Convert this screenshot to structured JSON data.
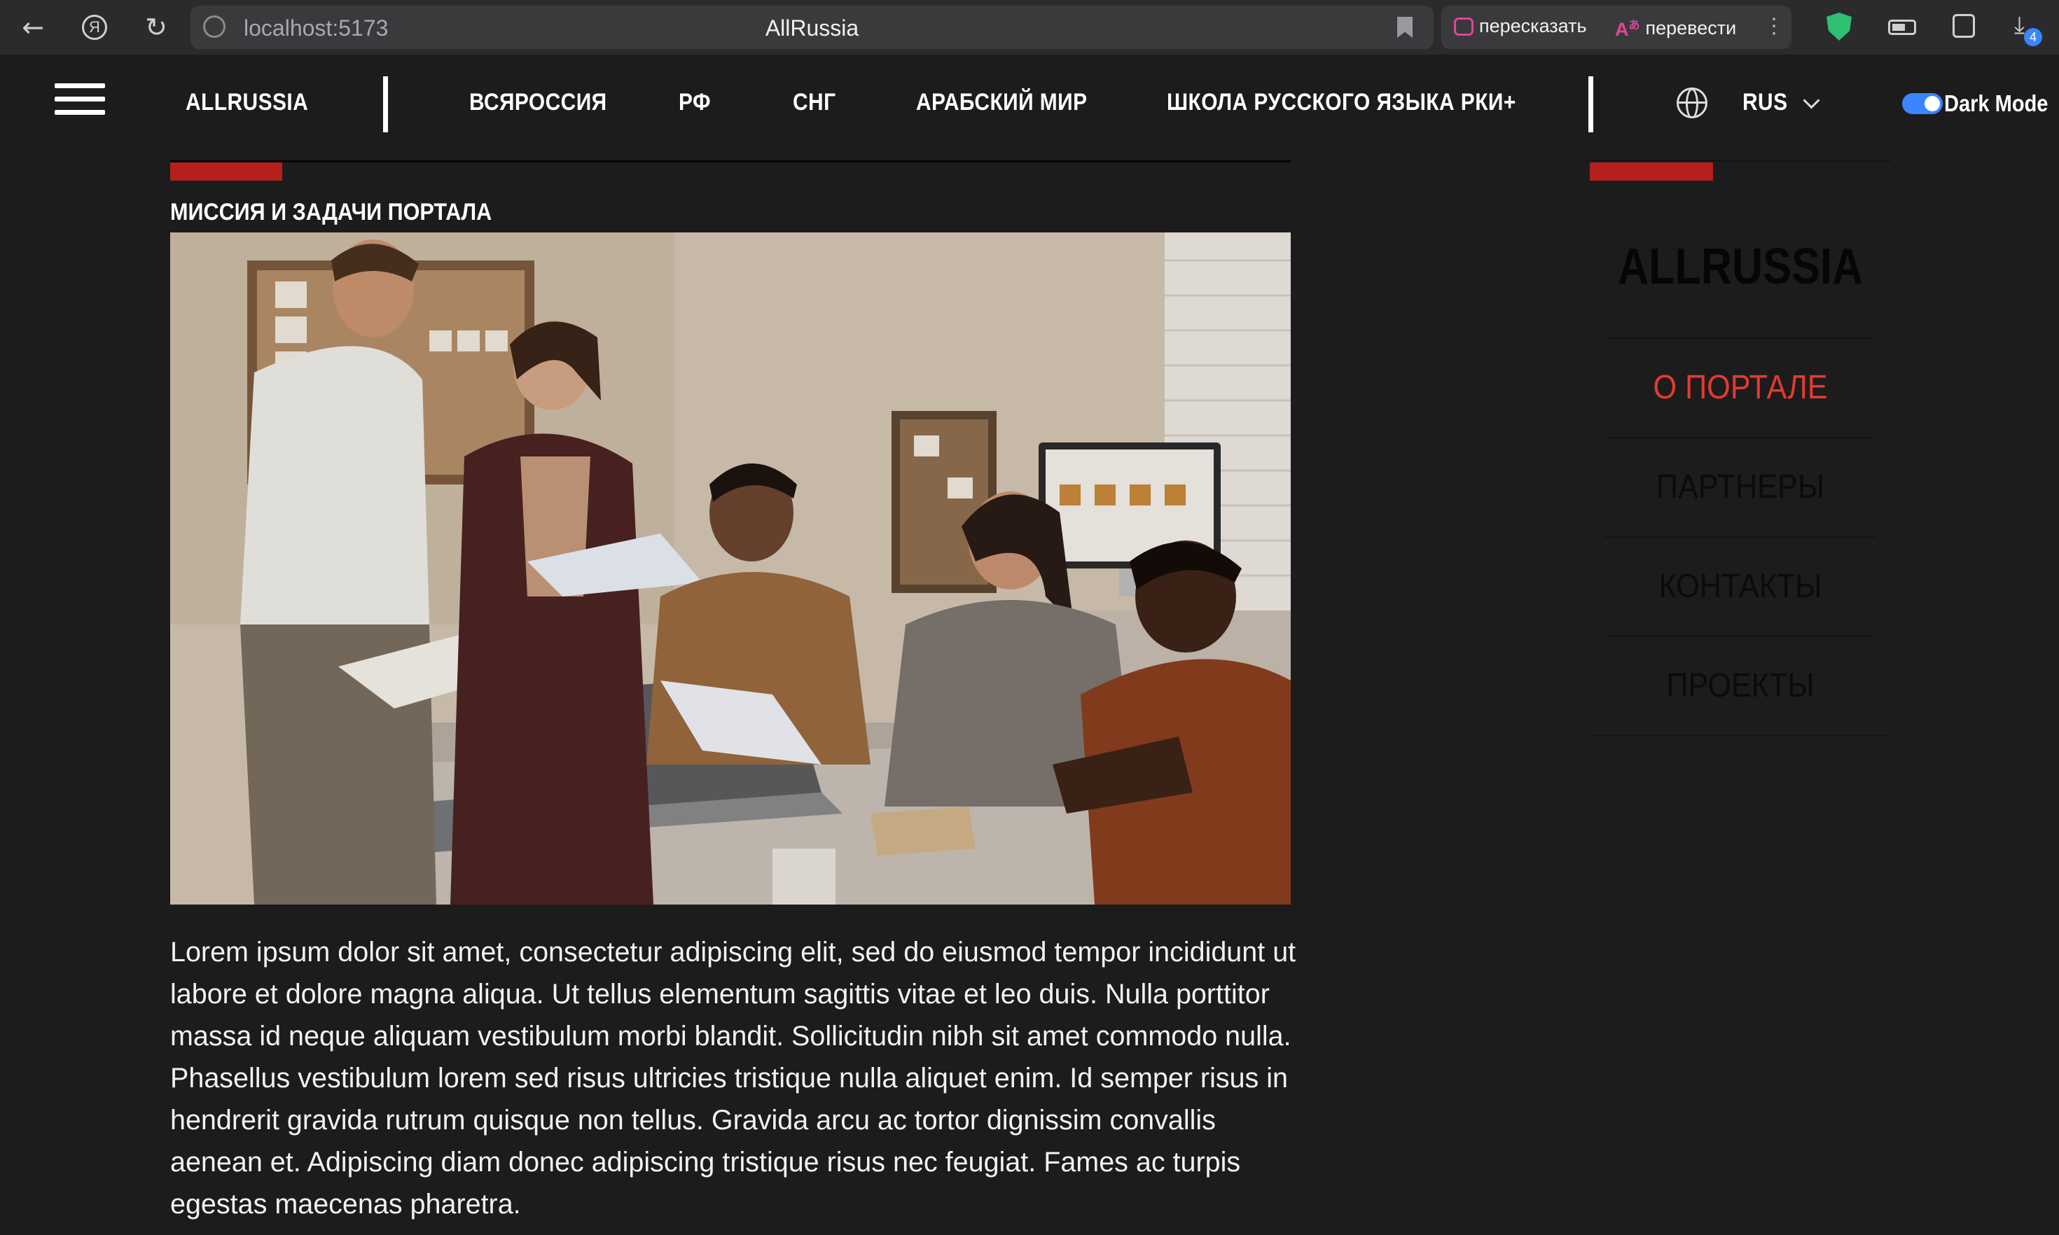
{
  "browser": {
    "url": "localhost:5173",
    "page_title": "AllRussia",
    "retell_label": "пересказать",
    "translate_label": "перевести",
    "downloads_badge": "4",
    "icons": [
      "back-arrow-icon",
      "yandex-icon",
      "reload-icon",
      "site-info-icon",
      "bookmark-icon",
      "shield-icon",
      "battery-icon",
      "tabs-icon",
      "downloads-icon"
    ]
  },
  "header": {
    "brand": "ALLRUSSIA",
    "nav": [
      "ВСЯРОССИЯ",
      "РФ",
      "СНГ",
      "АРАБСКИЙ МИР",
      "ШКОЛА РУССКОГО ЯЗЫКА РКИ+"
    ],
    "language": "RUS",
    "dark_mode_label": "Dark Mode",
    "dark_mode_on": true
  },
  "article": {
    "section_title": "МИССИЯ И ЗАДАЧИ ПОРТАЛА",
    "body": "Lorem ipsum dolor sit amet, consectetur adipiscing elit, sed do eiusmod tempor incididunt ut labore et dolore magna aliqua. Ut tellus elementum sagittis vitae et leo duis. Nulla porttitor massa id neque aliquam vestibulum morbi blandit. Sollicitudin nibh sit amet commodo nulla. Phasellus vestibulum lorem sed risus ultricies tristique nulla aliquet enim. Id semper risus in hendrerit gravida rutrum quisque non tellus. Gravida arcu ac tortor dignissim convallis aenean et. Adipiscing diam donec adipiscing tristique risus nec feugiat. Fames ac turpis egestas maecenas pharetra."
  },
  "sidebar": {
    "title": "ALLRUSSIA",
    "items": [
      {
        "label": "О ПОРТАЛЕ",
        "active": true
      },
      {
        "label": "ПАРТНЕРЫ",
        "active": false
      },
      {
        "label": "КОНТАКТЫ",
        "active": false
      },
      {
        "label": "ПРОЕКТЫ",
        "active": false
      }
    ]
  },
  "colors": {
    "background": "#1c1c1d",
    "accent_red": "#b3201d",
    "active_link": "#e53a2f",
    "toggle_blue": "#3a86ff"
  }
}
